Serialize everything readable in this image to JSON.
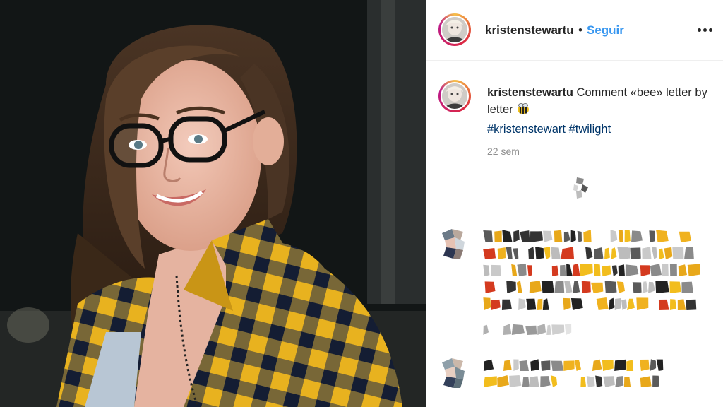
{
  "post": {
    "username": "kristenstewartu",
    "separator": "•",
    "follow_label": "Seguir",
    "caption_text": " Comment «bee» letter by letter",
    "hashtags": [
      "#kristenstewart",
      "#twilight"
    ],
    "time_ago": "22 sem"
  },
  "icons": {
    "more": "more-options-icon",
    "bee": "bee-emoji-icon",
    "loading": "loading-spinner-icon"
  },
  "colors": {
    "link_blue": "#3897f0",
    "hashtag": "#003569",
    "text": "#262626",
    "muted": "#8e8e8e",
    "shirt_yellow": "#e8b21f",
    "shirt_navy": "#1b2a4a"
  }
}
